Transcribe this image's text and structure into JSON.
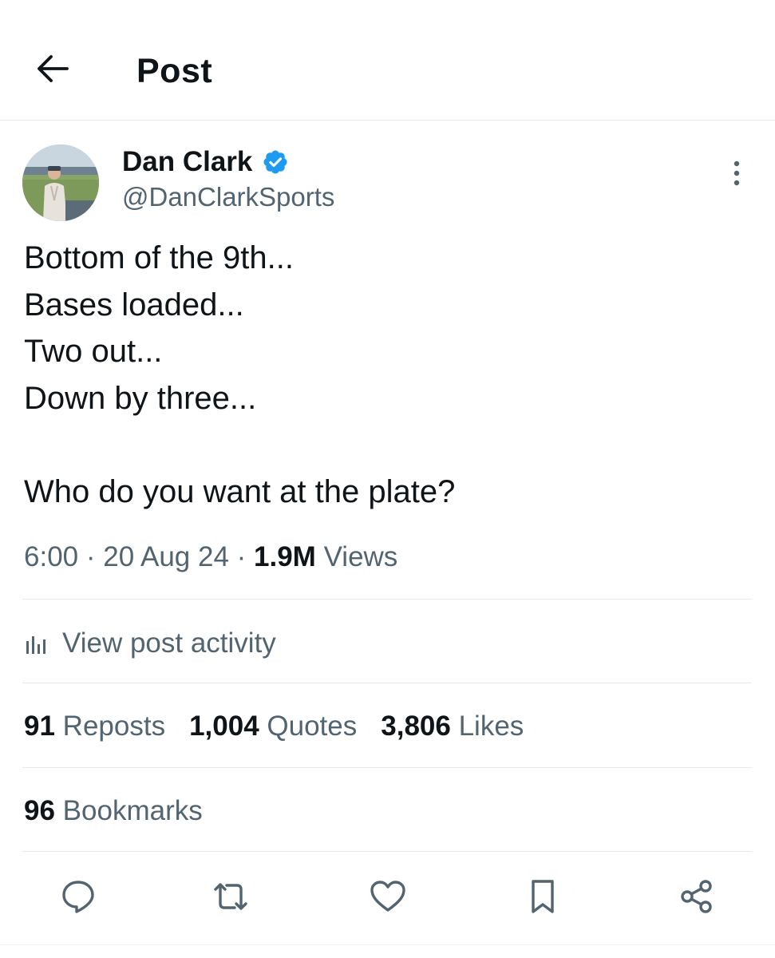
{
  "header": {
    "title": "Post",
    "back_icon": "arrow-left-icon"
  },
  "author": {
    "name": "Dan Clark",
    "handle": "@DanClarkSports",
    "verified": true,
    "verified_color": "#1d9bf0",
    "avatar_icon": "avatar-photo"
  },
  "post": {
    "lines": [
      "Bottom of the 9th...",
      "Bases loaded...",
      "Two out...",
      "Down by three...",
      "",
      "Who do you want at the plate?"
    ],
    "time": "6:00",
    "date": "20 Aug 24",
    "separator": "·",
    "views_count": "1.9M",
    "views_label": "Views"
  },
  "activity": {
    "label": "View post activity",
    "icon": "bar-chart-icon"
  },
  "stats": {
    "reposts_count": "91",
    "reposts_label": "Reposts",
    "quotes_count": "1,004",
    "quotes_label": "Quotes",
    "likes_count": "3,806",
    "likes_label": "Likes",
    "bookmarks_count": "96",
    "bookmarks_label": "Bookmarks"
  },
  "actions": [
    {
      "name": "reply",
      "icon": "reply-icon"
    },
    {
      "name": "repost",
      "icon": "repost-icon"
    },
    {
      "name": "like",
      "icon": "heart-icon"
    },
    {
      "name": "bookmark",
      "icon": "bookmark-icon"
    },
    {
      "name": "share",
      "icon": "share-icon"
    }
  ],
  "colors": {
    "text_primary": "#0f1419",
    "text_secondary": "#536471",
    "divider": "#e6e9ec",
    "accent": "#1d9bf0"
  }
}
